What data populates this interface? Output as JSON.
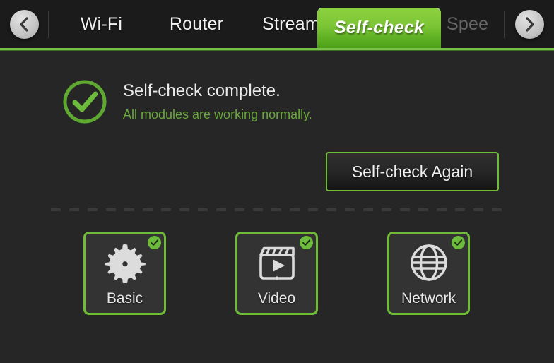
{
  "colors": {
    "accent_green": "#6fbd37",
    "tab_active_green": "#7cc636",
    "background": "#262626",
    "header_background": "#1b1b1b",
    "tile_background": "#333333",
    "text_primary": "#eaeaea",
    "text_dim": "#676767",
    "status_sub_green": "#6aa83c"
  },
  "header": {
    "prev_arrow": {
      "icon": "chevron-left-icon",
      "label": "Previous tabs"
    },
    "next_arrow": {
      "icon": "chevron-right-icon",
      "label": "Next tabs"
    },
    "tabs": [
      {
        "label": "Wi-Fi",
        "active": false,
        "truncated": false
      },
      {
        "label": "Router",
        "active": false,
        "truncated": false
      },
      {
        "label": "Stream",
        "active": false,
        "truncated": false
      },
      {
        "label": "Self-check",
        "active": true,
        "truncated": false
      },
      {
        "label": "Spee",
        "active": false,
        "truncated": true
      }
    ]
  },
  "status": {
    "icon": "check-circle-icon",
    "title": "Self-check complete.",
    "subtitle": "All modules are working normally."
  },
  "actions": {
    "recheck_label": "Self-check Again"
  },
  "modules": [
    {
      "label": "Basic",
      "icon": "gear-icon",
      "badge": "check-badge-icon",
      "status": "ok"
    },
    {
      "label": "Video",
      "icon": "clapperboard-play-icon",
      "badge": "check-badge-icon",
      "status": "ok"
    },
    {
      "label": "Network",
      "icon": "globe-icon",
      "badge": "check-badge-icon",
      "status": "ok"
    }
  ]
}
